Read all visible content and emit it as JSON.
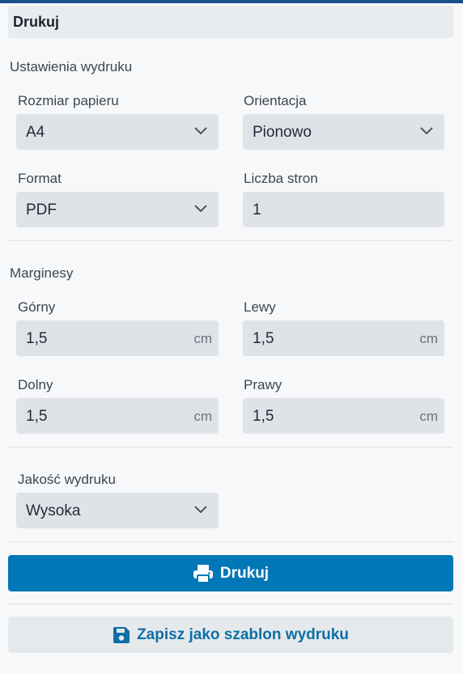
{
  "panel": {
    "title": "Drukuj"
  },
  "print_settings": {
    "section_label": "Ustawienia wydruku",
    "paper_size": {
      "label": "Rozmiar papieru",
      "value": "A4"
    },
    "orientation": {
      "label": "Orientacja",
      "value": "Pionowo"
    },
    "format": {
      "label": "Format",
      "value": "PDF"
    },
    "page_count": {
      "label": "Liczba stron",
      "value": "1"
    }
  },
  "margins": {
    "section_label": "Marginesy",
    "top": {
      "label": "Górny",
      "value": "1,5",
      "unit": "cm"
    },
    "left": {
      "label": "Lewy",
      "value": "1,5",
      "unit": "cm"
    },
    "bottom": {
      "label": "Dolny",
      "value": "1,5",
      "unit": "cm"
    },
    "right": {
      "label": "Prawy",
      "value": "1,5",
      "unit": "cm"
    }
  },
  "quality": {
    "label": "Jakość wydruku",
    "value": "Wysoka"
  },
  "actions": {
    "print_label": "Drukuj",
    "save_template_label": "Zapisz jako szablon wydruku"
  },
  "colors": {
    "primary": "#0077b6",
    "accent_text": "#0e6fa6",
    "field_bg": "#dfe3e8",
    "topbar": "#1b4f8a"
  },
  "icons": {
    "print": "printer-icon",
    "save": "floppy-disk-icon",
    "dropdown": "chevron-down-icon"
  }
}
